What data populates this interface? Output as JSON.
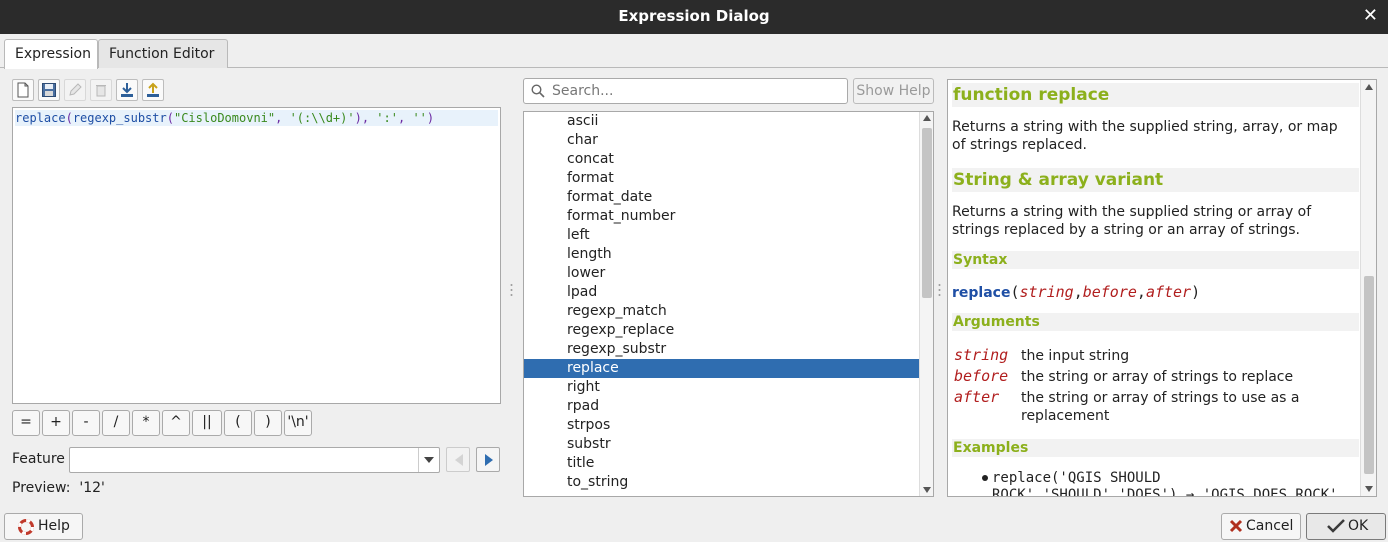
{
  "window": {
    "title": "Expression Dialog",
    "close_glyph": "✕"
  },
  "tabs": [
    {
      "label": "Expression",
      "active": true
    },
    {
      "label": "Function Editor",
      "active": false
    }
  ],
  "toolbar": {
    "icons": [
      "new-file-icon",
      "save-icon",
      "edit-icon",
      "delete-icon",
      "import-icon",
      "export-icon"
    ]
  },
  "editor": {
    "expression": "replace(regexp_substr(\"CisloDomovni\", '(:\\\\d+)'), ':', '')",
    "tokens": {
      "fn1": "replace",
      "p1": "(",
      "fn2": "regexp_substr",
      "p2": "(",
      "s1": "\"CisloDomovni\"",
      "c1": ", ",
      "s2": "'(:\\\\d+)'",
      "p3": ")",
      "c2": ", ",
      "s3": "':'",
      "c3": ", ",
      "s4": "''",
      "p4": ")"
    }
  },
  "operators": [
    "=",
    "+",
    "-",
    "/",
    "*",
    "^",
    "||",
    "(",
    ")",
    "'\\n'"
  ],
  "feature": {
    "label": "Feature",
    "value": ""
  },
  "preview": {
    "label": "Preview:",
    "value": "'12'"
  },
  "search": {
    "placeholder": "Search...",
    "value": ""
  },
  "show_help_label": "Show Help",
  "functions": {
    "items": [
      "ascii",
      "char",
      "concat",
      "format",
      "format_date",
      "format_number",
      "left",
      "length",
      "lower",
      "lpad",
      "regexp_match",
      "regexp_replace",
      "regexp_substr",
      "replace",
      "right",
      "rpad",
      "strpos",
      "substr",
      "title",
      "to_string"
    ],
    "selected": "replace"
  },
  "help": {
    "title": "function replace",
    "description": "Returns a string with the supplied string, array, or map of strings replaced.",
    "variant_title": "String & array variant",
    "variant_description": "Returns a string with the supplied string or array of strings replaced by a string or an array of strings.",
    "syntax_heading": "Syntax",
    "syntax": {
      "fn": "replace",
      "open": "(",
      "args": [
        "string",
        "before",
        "after"
      ],
      "sep": ",",
      "close": ")"
    },
    "arguments_heading": "Arguments",
    "arguments": [
      {
        "name": "string",
        "desc": "the input string"
      },
      {
        "name": "before",
        "desc": "the string or array of strings to replace"
      },
      {
        "name": "after",
        "desc": "the string or array of strings to use as a replacement"
      }
    ],
    "examples_heading": "Examples",
    "example_line1": "replace('QGIS SHOULD",
    "example_line2": "ROCK','SHOULD','DOES') → 'QGIS DOES ROCK'"
  },
  "footer": {
    "help_label": "Help",
    "cancel_label": "Cancel",
    "ok_label": "OK"
  },
  "colors": {
    "accent": "#2f6db0",
    "help_heading": "#8cb01c",
    "arg": "#b11e1e"
  }
}
